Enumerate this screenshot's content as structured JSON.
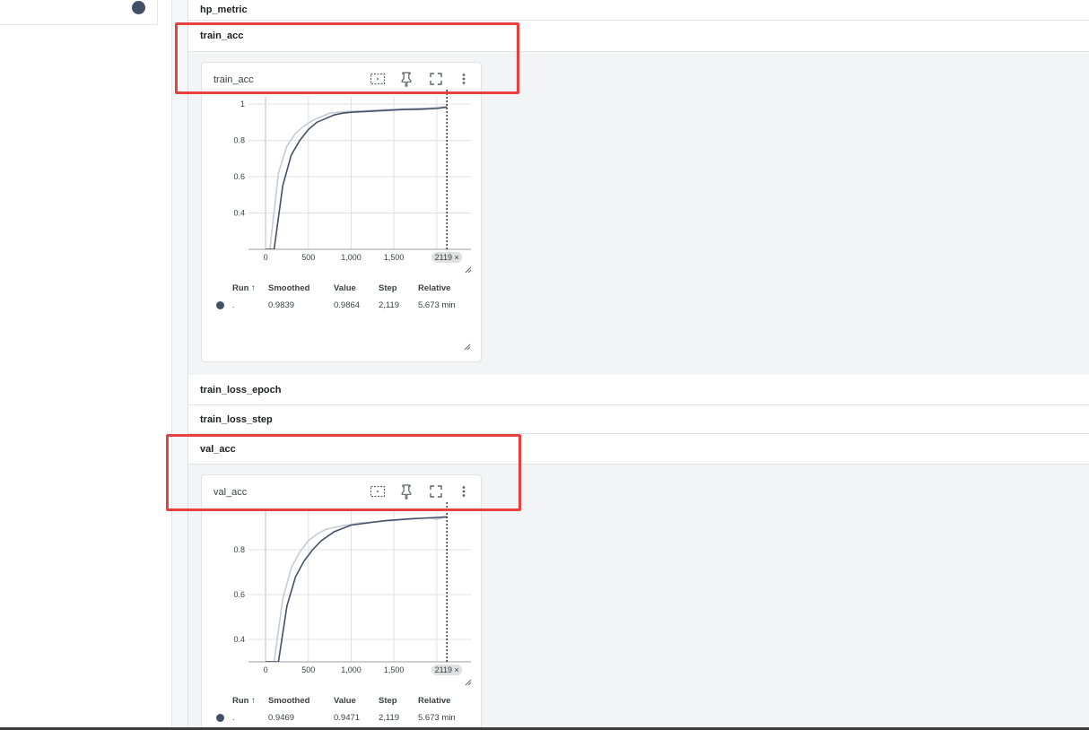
{
  "sidebar": {
    "run_color": "#425066"
  },
  "groups": [
    {
      "label": "hp_metric"
    },
    {
      "label": "train_acc"
    },
    {
      "label": "train_loss_epoch"
    },
    {
      "label": "train_loss_step"
    },
    {
      "label": "val_acc"
    }
  ],
  "cards": [
    {
      "title": "train_acc",
      "icons": [
        "fit-domain-icon",
        "pin-icon",
        "fullscreen-icon",
        "more-vert-icon"
      ],
      "table": {
        "headers": [
          "Run ↑",
          "Smoothed",
          "Value",
          "Step",
          "Relative"
        ],
        "row": {
          "run": ".",
          "smoothed": "0.9839",
          "value": "0.9864",
          "step": "2,119",
          "relative": "5.673 min"
        }
      },
      "step_badge": "2119 ×",
      "last_x_tick": "2"
    },
    {
      "title": "val_acc",
      "icons": [
        "fit-domain-icon",
        "pin-icon",
        "fullscreen-icon",
        "more-vert-icon"
      ],
      "table": {
        "headers": [
          "Run ↑",
          "Smoothed",
          "Value",
          "Step",
          "Relative"
        ],
        "row": {
          "run": ".",
          "smoothed": "0.9469",
          "value": "0.9471",
          "step": "2,119",
          "relative": "5.673 min"
        }
      },
      "step_badge": "2119 ×",
      "last_x_tick": "2"
    }
  ],
  "chart_data": [
    {
      "type": "line",
      "title": "train_acc",
      "x_ticks": [
        "0",
        "500",
        "1,000",
        "1,500"
      ],
      "y_ticks": [
        "0.4",
        "0.6",
        "0.8",
        "1"
      ],
      "xlim": [
        -200,
        2400
      ],
      "ylim": [
        0.2,
        1.04
      ],
      "marker_step": 2119,
      "series": [
        {
          "role": "smoothed",
          "color": "#425066",
          "x": [
            0,
            100,
            200,
            300,
            400,
            500,
            600,
            700,
            800,
            900,
            1000,
            1200,
            1400,
            1600,
            1800,
            2000,
            2119
          ],
          "y": [
            0.2,
            0.2,
            0.55,
            0.72,
            0.8,
            0.86,
            0.9,
            0.92,
            0.94,
            0.95,
            0.955,
            0.96,
            0.965,
            0.97,
            0.972,
            0.976,
            0.9839
          ]
        },
        {
          "role": "raw",
          "color": "#c5cbd8",
          "x": [
            0,
            50,
            150,
            250,
            350,
            450,
            550,
            650,
            750,
            850,
            950,
            1100,
            1300,
            1500,
            1700,
            1900,
            2119
          ],
          "y": [
            0.2,
            0.2,
            0.62,
            0.77,
            0.84,
            0.88,
            0.91,
            0.93,
            0.95,
            0.955,
            0.96,
            0.962,
            0.968,
            0.972,
            0.975,
            0.978,
            0.9864
          ]
        }
      ]
    },
    {
      "type": "line",
      "title": "val_acc",
      "x_ticks": [
        "0",
        "500",
        "1,000",
        "1,500"
      ],
      "y_ticks": [
        "0.4",
        "0.6",
        "0.8"
      ],
      "xlim": [
        -200,
        2400
      ],
      "ylim": [
        0.3,
        0.98
      ],
      "marker_step": 2119,
      "series": [
        {
          "role": "smoothed",
          "color": "#425066",
          "x": [
            0,
            150,
            250,
            350,
            450,
            550,
            650,
            800,
            1000,
            1200,
            1400,
            1600,
            1800,
            2000,
            2119
          ],
          "y": [
            0.3,
            0.3,
            0.55,
            0.68,
            0.75,
            0.8,
            0.84,
            0.88,
            0.91,
            0.92,
            0.93,
            0.935,
            0.94,
            0.944,
            0.9469
          ]
        },
        {
          "role": "raw",
          "color": "#c5cbd8",
          "x": [
            0,
            100,
            200,
            300,
            400,
            500,
            600,
            700,
            800,
            950,
            1100,
            1300,
            1500,
            1700,
            1900,
            2000,
            2119
          ],
          "y": [
            0.3,
            0.3,
            0.58,
            0.72,
            0.79,
            0.84,
            0.87,
            0.89,
            0.9,
            0.91,
            0.92,
            0.925,
            0.93,
            0.94,
            0.942,
            0.935,
            0.9471
          ]
        }
      ]
    }
  ]
}
